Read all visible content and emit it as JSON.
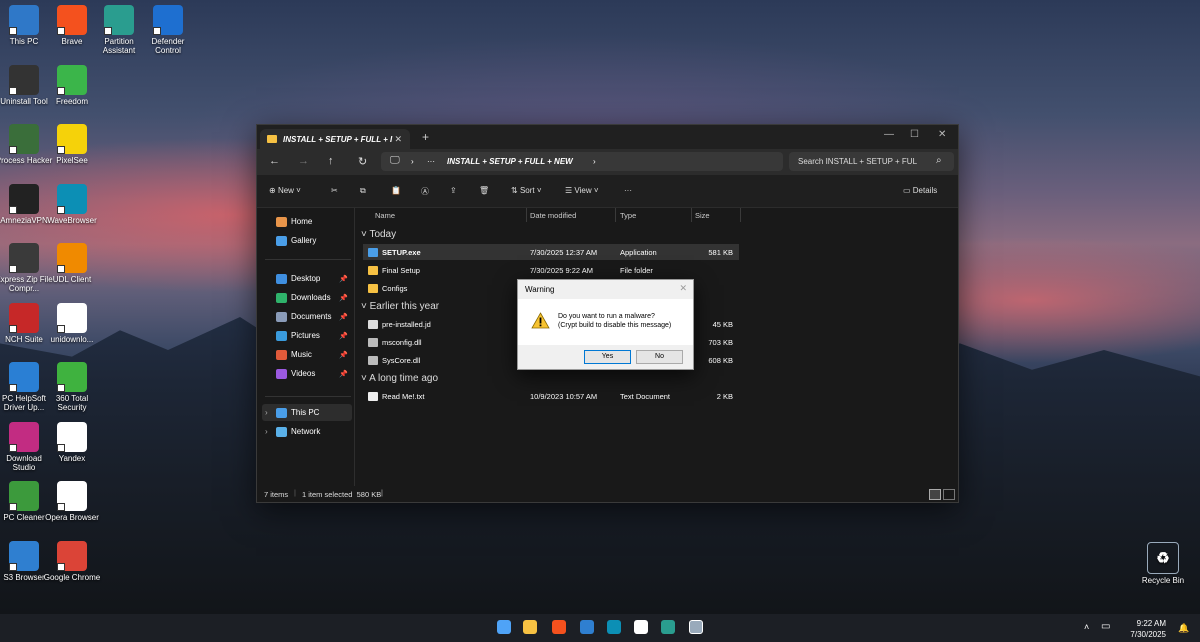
{
  "desktop_icons": [
    {
      "label": "This PC",
      "icon": "monitor-icon",
      "color": "#2f78c8"
    },
    {
      "label": "Brave",
      "icon": "brave-icon",
      "color": "#f4511e"
    },
    {
      "label": "Partition Assistant",
      "icon": "partition-icon",
      "color": "#2a9d8f"
    },
    {
      "label": "Defender Control",
      "icon": "shield-icon",
      "color": "#1e6fd0"
    },
    {
      "label": "Uninstall Tool",
      "icon": "uninstall-icon",
      "color": "#333333"
    },
    {
      "label": "Freedom",
      "icon": "butterfly-icon",
      "color": "#3bb54a"
    },
    {
      "label": "Process Hacker",
      "icon": "chip-icon",
      "color": "#3a6e3a"
    },
    {
      "label": "PixelSee",
      "icon": "play-icon",
      "color": "#f5d20a"
    },
    {
      "label": "AmneziaVPN",
      "icon": "vpn-icon",
      "color": "#222222"
    },
    {
      "label": "WaveBrowser",
      "icon": "wave-icon",
      "color": "#0c8fb5"
    },
    {
      "label": "Express Zip File Compr...",
      "icon": "zip-icon",
      "color": "#3a3a3a"
    },
    {
      "label": "UDL Client",
      "icon": "play-icon",
      "color": "#f08a00"
    },
    {
      "label": "NCH Suite",
      "icon": "nch-icon",
      "color": "#c62828"
    },
    {
      "label": "unidownlo...",
      "icon": "document-icon",
      "color": "#ffffff"
    },
    {
      "label": "PC HelpSoft Driver Up...",
      "icon": "monitor-icon",
      "color": "#2a7fd4"
    },
    {
      "label": "360 Total Security",
      "icon": "plus-icon",
      "color": "#3fb23f"
    },
    {
      "label": "Download Studio",
      "icon": "ds-icon",
      "color": "#c22c82"
    },
    {
      "label": "Yandex",
      "icon": "yandex-icon",
      "color": "#ffffff"
    },
    {
      "label": "PC Cleaner",
      "icon": "recycle-icon",
      "color": "#3c9a3c"
    },
    {
      "label": "Opera Browser",
      "icon": "document-icon",
      "color": "#ffffff"
    },
    {
      "label": "S3 Browser",
      "icon": "s3-icon",
      "color": "#2f7fd0"
    },
    {
      "label": "Google Chrome",
      "icon": "chrome-icon",
      "color": "#db4437"
    }
  ],
  "recycle_bin": {
    "label": "Recycle Bin",
    "icon": "recycle-bin-icon"
  },
  "explorer": {
    "tab_title": "INSTALL + SETUP + FULL + I",
    "address_path": "INSTALL + SETUP + FULL + NEW",
    "search_placeholder": "Search INSTALL + SETUP + FUL",
    "toolbar": {
      "new": "New",
      "sort": "Sort",
      "view": "View",
      "details": "Details"
    },
    "sidebar": {
      "quick": [
        {
          "label": "Home",
          "icon": "home-icon",
          "color": "#e8954a"
        },
        {
          "label": "Gallery",
          "icon": "gallery-icon",
          "color": "#4a9ee8"
        }
      ],
      "pinned": [
        {
          "label": "Desktop",
          "icon": "desktop-icon",
          "color": "#3f8fe0"
        },
        {
          "label": "Downloads",
          "icon": "download-icon",
          "color": "#2fb36b"
        },
        {
          "label": "Documents",
          "icon": "documents-icon",
          "color": "#8a9bb8"
        },
        {
          "label": "Pictures",
          "icon": "pictures-icon",
          "color": "#3a9bdc"
        },
        {
          "label": "Music",
          "icon": "music-icon",
          "color": "#e05a3a"
        },
        {
          "label": "Videos",
          "icon": "videos-icon",
          "color": "#9b59e0"
        }
      ],
      "this_pc": "This PC",
      "network": "Network"
    },
    "columns": {
      "name": "Name",
      "date": "Date modified",
      "type": "Type",
      "size": "Size"
    },
    "groups": {
      "today": "Today",
      "earlier": "Earlier this year",
      "longago": "A long time ago"
    },
    "files_today": [
      {
        "name": "SETUP.exe",
        "date": "7/30/2025 12:37 AM",
        "type": "Application",
        "size": "581 KB",
        "icon": "exe-icon"
      },
      {
        "name": "Final Setup",
        "date": "7/30/2025 9:22 AM",
        "type": "File folder",
        "size": "",
        "icon": "folder-icon"
      },
      {
        "name": "Configs",
        "date": "",
        "type": "",
        "size": "",
        "icon": "folder-icon"
      }
    ],
    "files_earlier": [
      {
        "name": "pre-installed.jd",
        "size": "45 KB",
        "icon": "file-icon"
      },
      {
        "name": "msconfig.dll",
        "size": "703 KB",
        "icon": "dll-icon"
      },
      {
        "name": "SysCore.dll",
        "size": "608 KB",
        "icon": "dll-icon"
      }
    ],
    "files_longago": [
      {
        "name": "Read Me!.txt",
        "date": "10/9/2023 10:57 AM",
        "type": "Text Document",
        "size": "2 KB",
        "icon": "txt-icon"
      }
    ],
    "status": {
      "items": "7 items",
      "selected": "1 item selected  580 KB"
    }
  },
  "dialog": {
    "title": "Warning",
    "line1": "Do you want to run a malware?",
    "line2": "(Crypt build to disable this message)",
    "yes": "Yes",
    "no": "No"
  },
  "taskbar": {
    "time": "9:22 AM",
    "date": "7/30/2025"
  }
}
